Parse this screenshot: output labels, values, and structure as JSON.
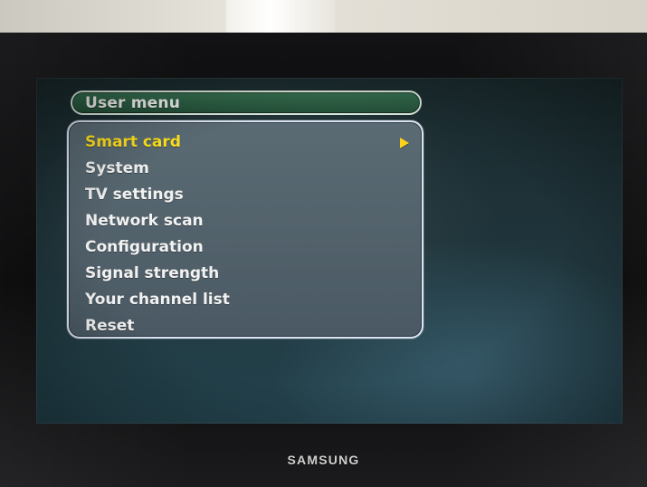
{
  "brand": {
    "name": "SAMSUNG"
  },
  "menu": {
    "title": "User menu",
    "items": [
      {
        "label": "Smart card",
        "selected": true,
        "has_submenu": true
      },
      {
        "label": "System",
        "selected": false,
        "has_submenu": false
      },
      {
        "label": "TV settings",
        "selected": false,
        "has_submenu": false
      },
      {
        "label": "Network scan",
        "selected": false,
        "has_submenu": false
      },
      {
        "label": "Configuration",
        "selected": false,
        "has_submenu": false
      },
      {
        "label": "Signal strength",
        "selected": false,
        "has_submenu": false
      },
      {
        "label": "Your channel list",
        "selected": false,
        "has_submenu": false
      },
      {
        "label": "Reset",
        "selected": false,
        "has_submenu": false
      }
    ]
  },
  "colors": {
    "title_bar_green": "#2f6647",
    "panel_gray_blue": "#53636d",
    "panel_border": "#dbe4f0",
    "selected_text": "#ffe11e",
    "normal_text": "#f2f2f2"
  },
  "icons": {
    "submenu_arrow": "play-triangle-icon"
  }
}
